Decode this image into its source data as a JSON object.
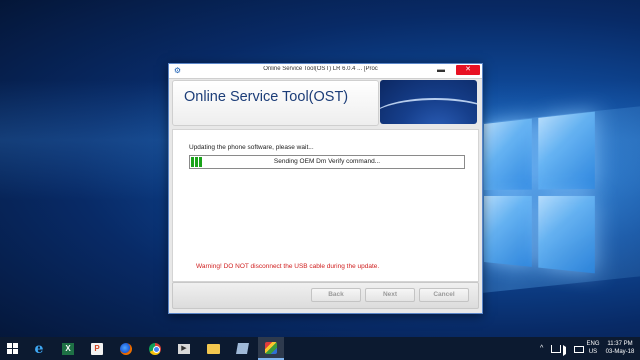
{
  "window": {
    "title": "Online Service Tool(OST) LR 6.0.4 ... [Proc",
    "minimize_glyph": "▬",
    "close_glyph": "✕",
    "heading": "Online Service Tool(OST)"
  },
  "content": {
    "status_label": "Updating the phone software, please wait...",
    "progress_text": "Sending OEM Dm Verify command...",
    "progress_fraction": 0.04,
    "warning": "Warning! DO NOT disconnect the USB cable during the update."
  },
  "buttons": {
    "back": "Back",
    "next": "Next",
    "cancel": "Cancel"
  },
  "taskbar": {
    "icons": [
      "windows-start-icon",
      "search-icon",
      "task-view-icon",
      "internet-explorer-icon",
      "excel-icon",
      "powerpoint-icon",
      "firefox-icon",
      "chrome-icon",
      "media-player-icon",
      "file-explorer-icon",
      "notepad-icon",
      "ost-app-icon"
    ],
    "tray_overflow": "^",
    "language_line1": "ENG",
    "language_line2": "US",
    "time": "11:37 PM",
    "date": "03-May-18"
  },
  "colors": {
    "accent": "#1c3d78",
    "warning": "#d02020",
    "progress": "#1aa31a",
    "close": "#e81123"
  }
}
